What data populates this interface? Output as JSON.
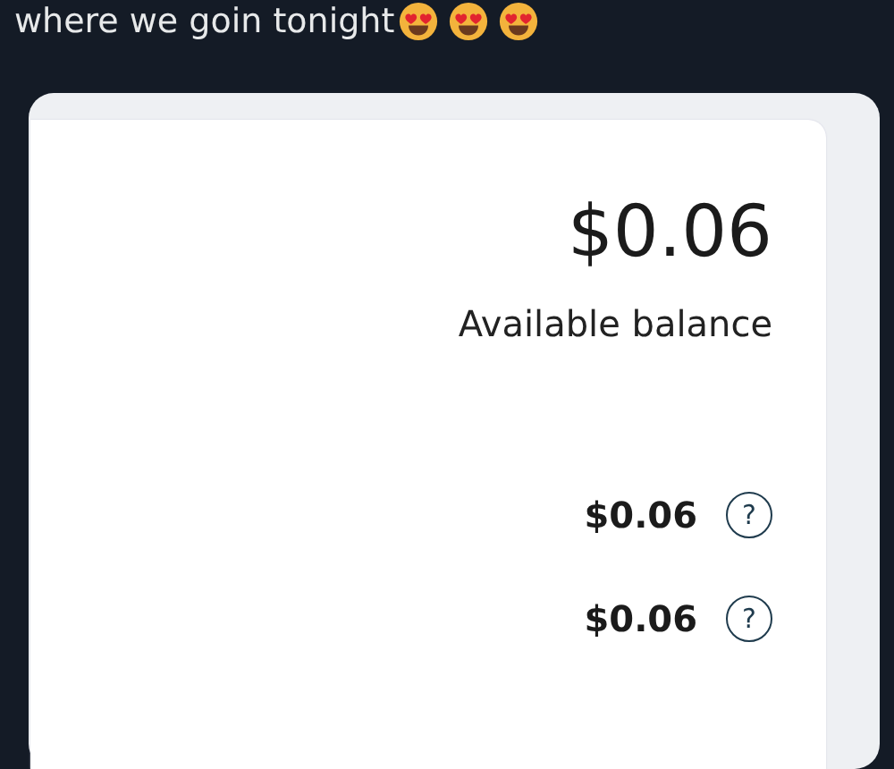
{
  "post": {
    "text": "where we goin tonight"
  },
  "balance": {
    "amount": "$0.06",
    "label": "Available balance"
  },
  "rows": [
    {
      "amount": "$0.06",
      "help": "?"
    },
    {
      "amount": "$0.06",
      "help": "?"
    }
  ]
}
